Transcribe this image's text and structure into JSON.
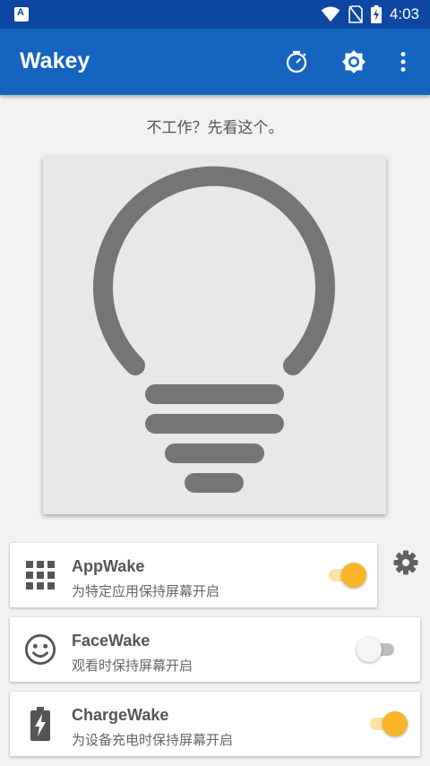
{
  "status_bar": {
    "notification_icon": "a-icon",
    "notification_letter": "A",
    "icons": [
      "wifi-icon",
      "no-sim-icon",
      "battery-charging-icon"
    ],
    "time": "4:03"
  },
  "app_bar": {
    "title": "Wakey",
    "actions": [
      "timer-icon",
      "brightness-icon",
      "more-vert-icon"
    ],
    "color": "#1565c0",
    "status_color": "#0d47a1"
  },
  "hint_text": "不工作？先看这个。",
  "bulb": {
    "icon": "lightbulb-icon",
    "color": "#757575",
    "background": "#e8e8e8"
  },
  "wake_options": [
    {
      "title": "AppWake",
      "subtitle": "为特定应用保持屏幕开启",
      "icon": "apps-grid-icon",
      "enabled": true
    },
    {
      "title": "FaceWake",
      "subtitle": "观看时保持屏幕开启",
      "icon": "smiley-face-icon",
      "enabled": false
    },
    {
      "title": "ChargeWake",
      "subtitle": "为设备充电时保持屏幕开启",
      "icon": "battery-charging-icon",
      "enabled": true
    }
  ],
  "accent_color": "#f9b428",
  "side_settings_icon": "gear-icon"
}
